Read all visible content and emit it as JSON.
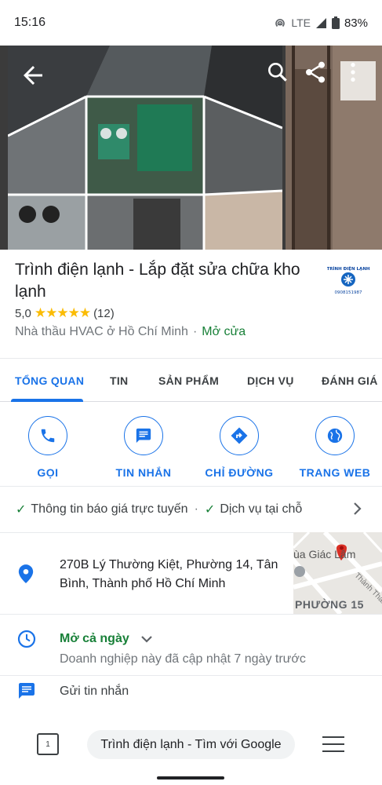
{
  "status_bar": {
    "time": "15:16",
    "network": "LTE",
    "battery": "83%"
  },
  "place": {
    "title": "Trình điện lạnh - Lắp đặt sửa chữa kho lạnh",
    "rating": "5,0",
    "stars": "★★★★★",
    "review_count": "(12)",
    "category": "Nhà thầu HVAC ở Hồ Chí Minh",
    "separator": "·",
    "open_status": "Mở cửa",
    "logo_text_top": "TRÌNH ĐIỆN LẠNH",
    "logo_text_bottom": "0908151987"
  },
  "tabs": [
    {
      "label": "TỔNG QUAN"
    },
    {
      "label": "TIN"
    },
    {
      "label": "SẢN PHẨM"
    },
    {
      "label": "DỊCH VỤ"
    },
    {
      "label": "ĐÁNH GIÁ"
    }
  ],
  "actions": [
    {
      "label": "GỌI",
      "icon": "phone-icon"
    },
    {
      "label": "TIN NHẮN",
      "icon": "message-icon"
    },
    {
      "label": "CHỈ ĐƯỜNG",
      "icon": "directions-icon"
    },
    {
      "label": "TRANG WEB",
      "icon": "globe-icon"
    }
  ],
  "attributes": {
    "item1": "Thông tin báo giá trực tuyến",
    "separator": "·",
    "item2": "Dịch vụ tại chỗ"
  },
  "address": {
    "text": "270B Lý Thường Kiệt, Phường 14, Tân Bình, Thành phố Hồ Chí Minh",
    "map_label_1": "ùa Giác Lâm",
    "map_label_2": "PHƯỜNG 15",
    "map_label_3": "Thành Thái"
  },
  "hours": {
    "status": "Mở cả ngày",
    "updated": "Doanh nghiệp này đã cập nhật 7 ngày trước"
  },
  "message": {
    "label": "Gửi tin nhắn"
  },
  "browser": {
    "tab_count": "1",
    "omnibox_text": "Trình điện lạnh - Tìm với Google"
  },
  "colors": {
    "accent": "#1a73e8",
    "open_green": "#188038",
    "star": "#fbbc04"
  }
}
